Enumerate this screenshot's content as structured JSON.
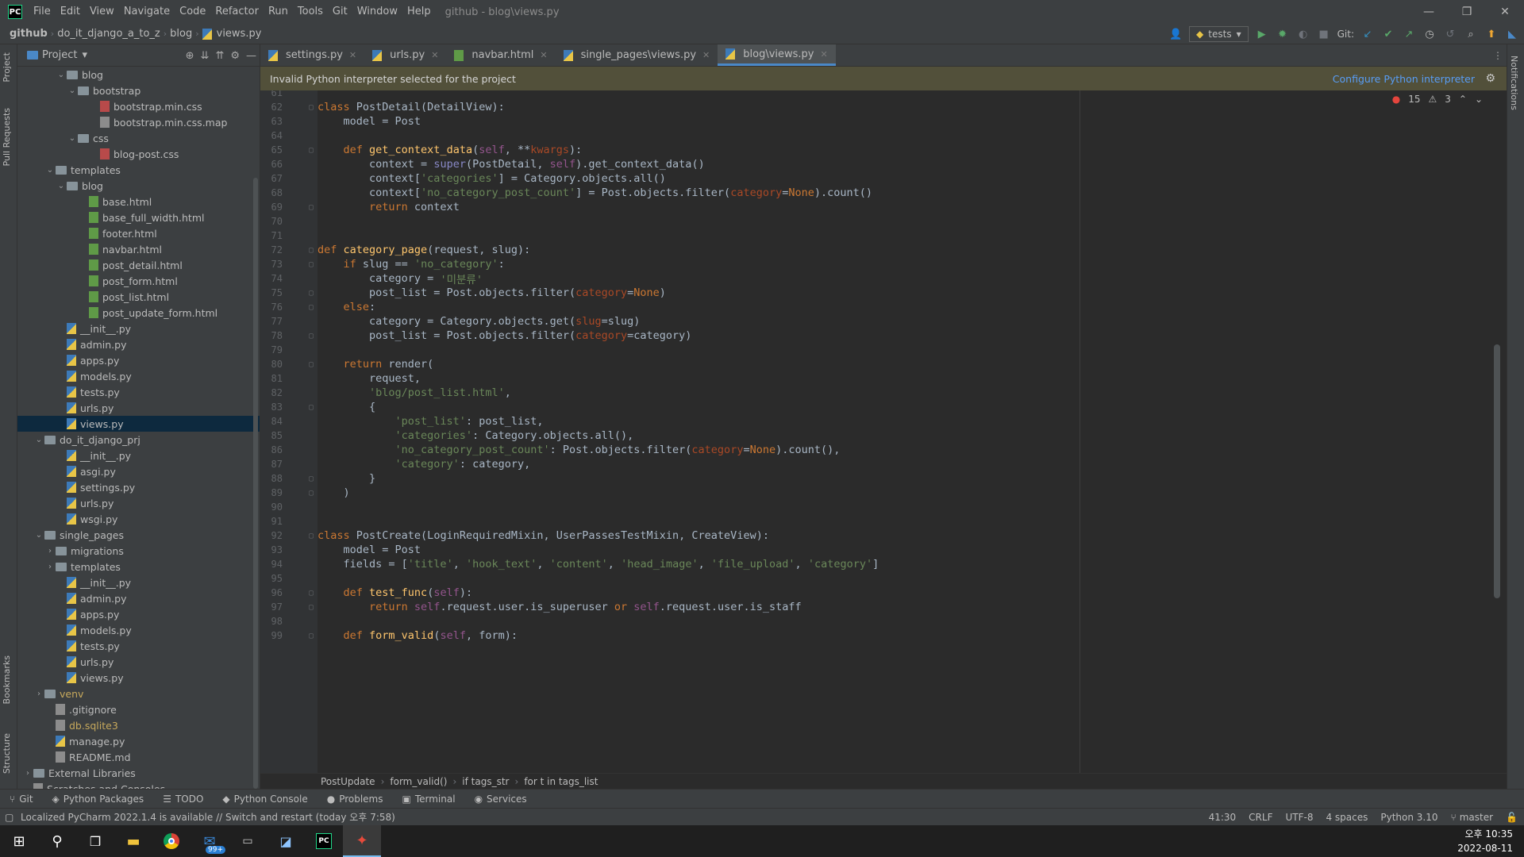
{
  "titlebar": {
    "app_logo": "PC",
    "menu": [
      "File",
      "Edit",
      "View",
      "Navigate",
      "Code",
      "Refactor",
      "Run",
      "Tools",
      "Git",
      "Window",
      "Help"
    ],
    "window_title": "github - blog\\views.py"
  },
  "navbar": {
    "breadcrumbs": [
      "github",
      "do_it_django_a_to_z",
      "blog",
      "views.py"
    ],
    "run_config": "tests",
    "git_label": "Git:"
  },
  "left_strip": {
    "project": "Project",
    "pull_requests": "Pull Requests",
    "bookmarks": "Bookmarks",
    "structure": "Structure"
  },
  "right_strip": {
    "notifications": "Notifications"
  },
  "project_panel": {
    "title": "Project",
    "tree": [
      {
        "label": "blog",
        "type": "folder",
        "depth": 4,
        "open": true
      },
      {
        "label": "bootstrap",
        "type": "folder",
        "depth": 5,
        "open": true
      },
      {
        "label": "bootstrap.min.css",
        "type": "css",
        "depth": 7
      },
      {
        "label": "bootstrap.min.css.map",
        "type": "gen",
        "depth": 7
      },
      {
        "label": "css",
        "type": "folder",
        "depth": 5,
        "open": true
      },
      {
        "label": "blog-post.css",
        "type": "css",
        "depth": 7
      },
      {
        "label": "templates",
        "type": "folder",
        "depth": 3,
        "open": true
      },
      {
        "label": "blog",
        "type": "folder",
        "depth": 4,
        "open": true
      },
      {
        "label": "base.html",
        "type": "html",
        "depth": 6
      },
      {
        "label": "base_full_width.html",
        "type": "html",
        "depth": 6
      },
      {
        "label": "footer.html",
        "type": "html",
        "depth": 6
      },
      {
        "label": "navbar.html",
        "type": "html",
        "depth": 6
      },
      {
        "label": "post_detail.html",
        "type": "html",
        "depth": 6
      },
      {
        "label": "post_form.html",
        "type": "html",
        "depth": 6
      },
      {
        "label": "post_list.html",
        "type": "html",
        "depth": 6
      },
      {
        "label": "post_update_form.html",
        "type": "html",
        "depth": 6
      },
      {
        "label": "__init__.py",
        "type": "py",
        "depth": 4
      },
      {
        "label": "admin.py",
        "type": "py",
        "depth": 4
      },
      {
        "label": "apps.py",
        "type": "py",
        "depth": 4
      },
      {
        "label": "models.py",
        "type": "py",
        "depth": 4
      },
      {
        "label": "tests.py",
        "type": "py",
        "depth": 4
      },
      {
        "label": "urls.py",
        "type": "py",
        "depth": 4
      },
      {
        "label": "views.py",
        "type": "py",
        "depth": 4,
        "selected": true
      },
      {
        "label": "do_it_django_prj",
        "type": "folder",
        "depth": 2,
        "open": true
      },
      {
        "label": "__init__.py",
        "type": "py",
        "depth": 4
      },
      {
        "label": "asgi.py",
        "type": "py",
        "depth": 4
      },
      {
        "label": "settings.py",
        "type": "py",
        "depth": 4
      },
      {
        "label": "urls.py",
        "type": "py",
        "depth": 4
      },
      {
        "label": "wsgi.py",
        "type": "py",
        "depth": 4
      },
      {
        "label": "single_pages",
        "type": "folder",
        "depth": 2,
        "open": true
      },
      {
        "label": "migrations",
        "type": "folder",
        "depth": 3,
        "open": false
      },
      {
        "label": "templates",
        "type": "folder",
        "depth": 3,
        "open": false
      },
      {
        "label": "__init__.py",
        "type": "py",
        "depth": 4
      },
      {
        "label": "admin.py",
        "type": "py",
        "depth": 4
      },
      {
        "label": "apps.py",
        "type": "py",
        "depth": 4
      },
      {
        "label": "models.py",
        "type": "py",
        "depth": 4
      },
      {
        "label": "tests.py",
        "type": "py",
        "depth": 4
      },
      {
        "label": "urls.py",
        "type": "py",
        "depth": 4
      },
      {
        "label": "views.py",
        "type": "py",
        "depth": 4
      },
      {
        "label": "venv",
        "type": "folder",
        "depth": 2,
        "open": false,
        "excluded": true
      },
      {
        "label": ".gitignore",
        "type": "gen",
        "depth": 3
      },
      {
        "label": "db.sqlite3",
        "type": "gen",
        "depth": 3,
        "excluded": true
      },
      {
        "label": "manage.py",
        "type": "py",
        "depth": 3
      },
      {
        "label": "README.md",
        "type": "gen",
        "depth": 3
      },
      {
        "label": "External Libraries",
        "type": "lib",
        "depth": 1,
        "open": false
      },
      {
        "label": "Scratches and Consoles",
        "type": "scratch",
        "depth": 1
      }
    ]
  },
  "tabs": [
    {
      "label": "settings.py",
      "type": "py"
    },
    {
      "label": "urls.py",
      "type": "py"
    },
    {
      "label": "navbar.html",
      "type": "html"
    },
    {
      "label": "single_pages\\views.py",
      "type": "py"
    },
    {
      "label": "blog\\views.py",
      "type": "py",
      "active": true
    }
  ],
  "warning_bar": {
    "message": "Invalid Python interpreter selected for the project",
    "link": "Configure Python interpreter"
  },
  "inspections": {
    "errors": "15",
    "warnings": "3"
  },
  "code_lines": [
    {
      "n": "61",
      "t": []
    },
    {
      "n": "62",
      "f": "▢",
      "t": [
        [
          "kw",
          "class "
        ],
        [
          "code",
          "PostDetail(DetailView):"
        ]
      ]
    },
    {
      "n": "63",
      "t": [
        [
          "code",
          "    model = Post"
        ]
      ]
    },
    {
      "n": "64",
      "t": []
    },
    {
      "n": "65",
      "f": "▢",
      "t": [
        [
          "kw",
          "    def "
        ],
        [
          "fn",
          "get_context_data"
        ],
        [
          "code",
          "("
        ],
        [
          "self",
          "self"
        ],
        [
          "code",
          ", **"
        ],
        [
          "param",
          "kwargs"
        ],
        [
          "code",
          "):"
        ]
      ]
    },
    {
      "n": "66",
      "t": [
        [
          "code",
          "        context = "
        ],
        [
          "bi",
          "super"
        ],
        [
          "code",
          "(PostDetail, "
        ],
        [
          "self",
          "self"
        ],
        [
          "code",
          ").get_context_data()"
        ]
      ]
    },
    {
      "n": "67",
      "t": [
        [
          "code",
          "        context["
        ],
        [
          "str",
          "'categories'"
        ],
        [
          "code",
          "] = Category.objects.all()"
        ]
      ]
    },
    {
      "n": "68",
      "t": [
        [
          "code",
          "        context["
        ],
        [
          "str",
          "'no_category_post_count'"
        ],
        [
          "code",
          "] = Post.objects.filter("
        ],
        [
          "param",
          "category"
        ],
        [
          "code",
          "="
        ],
        [
          "kw",
          "None"
        ],
        [
          "code",
          ").count()"
        ]
      ]
    },
    {
      "n": "69",
      "f": "▢",
      "t": [
        [
          "kw",
          "        return "
        ],
        [
          "code",
          "context"
        ]
      ]
    },
    {
      "n": "70",
      "t": []
    },
    {
      "n": "71",
      "t": []
    },
    {
      "n": "72",
      "f": "▢",
      "t": [
        [
          "kw",
          "def "
        ],
        [
          "fn",
          "category_page"
        ],
        [
          "code",
          "(request, slug):"
        ]
      ]
    },
    {
      "n": "73",
      "f": "▢",
      "t": [
        [
          "kw",
          "    if "
        ],
        [
          "code",
          "slug == "
        ],
        [
          "str",
          "'no_category'"
        ],
        [
          "code",
          ":"
        ]
      ]
    },
    {
      "n": "74",
      "t": [
        [
          "code",
          "        category = "
        ],
        [
          "str",
          "'미분류'"
        ]
      ]
    },
    {
      "n": "75",
      "f": "▢",
      "t": [
        [
          "code",
          "        post_list = Post.objects.filter("
        ],
        [
          "param",
          "category"
        ],
        [
          "code",
          "="
        ],
        [
          "kw",
          "None"
        ],
        [
          "code",
          ")"
        ]
      ]
    },
    {
      "n": "76",
      "f": "▢",
      "t": [
        [
          "kw",
          "    else"
        ],
        [
          "code",
          ":"
        ]
      ]
    },
    {
      "n": "77",
      "t": [
        [
          "code",
          "        category = Category.objects.get("
        ],
        [
          "param",
          "slug"
        ],
        [
          "code",
          "=slug)"
        ]
      ]
    },
    {
      "n": "78",
      "f": "▢",
      "t": [
        [
          "code",
          "        post_list = Post.objects.filter("
        ],
        [
          "param",
          "category"
        ],
        [
          "code",
          "=category)"
        ]
      ]
    },
    {
      "n": "79",
      "t": []
    },
    {
      "n": "80",
      "f": "▢",
      "t": [
        [
          "kw",
          "    return "
        ],
        [
          "code",
          "render("
        ]
      ]
    },
    {
      "n": "81",
      "t": [
        [
          "code",
          "        request,"
        ]
      ]
    },
    {
      "n": "82",
      "t": [
        [
          "str",
          "        'blog/post_list.html'"
        ],
        [
          "code",
          ","
        ]
      ]
    },
    {
      "n": "83",
      "f": "▢",
      "t": [
        [
          "code",
          "        {"
        ]
      ]
    },
    {
      "n": "84",
      "t": [
        [
          "str",
          "            'post_list'"
        ],
        [
          "code",
          ": post_list,"
        ]
      ]
    },
    {
      "n": "85",
      "t": [
        [
          "str",
          "            'categories'"
        ],
        [
          "code",
          ": Category.objects.all(),"
        ]
      ]
    },
    {
      "n": "86",
      "t": [
        [
          "str",
          "            'no_category_post_count'"
        ],
        [
          "code",
          ": Post.objects.filter("
        ],
        [
          "param",
          "category"
        ],
        [
          "code",
          "="
        ],
        [
          "kw",
          "None"
        ],
        [
          "code",
          ").count(),"
        ]
      ]
    },
    {
      "n": "87",
      "t": [
        [
          "str",
          "            'category'"
        ],
        [
          "code",
          ": category,"
        ]
      ]
    },
    {
      "n": "88",
      "f": "▢",
      "t": [
        [
          "code",
          "        }"
        ]
      ]
    },
    {
      "n": "89",
      "f": "▢",
      "t": [
        [
          "code",
          "    )"
        ]
      ]
    },
    {
      "n": "90",
      "t": []
    },
    {
      "n": "91",
      "t": []
    },
    {
      "n": "92",
      "f": "▢",
      "t": [
        [
          "kw",
          "class "
        ],
        [
          "code",
          "PostCreate(LoginRequiredMixin, UserPassesTestMixin, CreateView):"
        ]
      ]
    },
    {
      "n": "93",
      "t": [
        [
          "code",
          "    model = Post"
        ]
      ]
    },
    {
      "n": "94",
      "t": [
        [
          "code",
          "    fields = ["
        ],
        [
          "str",
          "'title'"
        ],
        [
          "code",
          ", "
        ],
        [
          "str",
          "'hook_text'"
        ],
        [
          "code",
          ", "
        ],
        [
          "str",
          "'content'"
        ],
        [
          "code",
          ", "
        ],
        [
          "str",
          "'head_image'"
        ],
        [
          "code",
          ", "
        ],
        [
          "str",
          "'file_upload'"
        ],
        [
          "code",
          ", "
        ],
        [
          "str",
          "'category'"
        ],
        [
          "code",
          "]"
        ]
      ]
    },
    {
      "n": "95",
      "t": []
    },
    {
      "n": "96",
      "f": "▢",
      "t": [
        [
          "kw",
          "    def "
        ],
        [
          "fn",
          "test_func"
        ],
        [
          "code",
          "("
        ],
        [
          "self",
          "self"
        ],
        [
          "code",
          "):"
        ]
      ]
    },
    {
      "n": "97",
      "f": "▢",
      "t": [
        [
          "kw",
          "        return "
        ],
        [
          "self",
          "self"
        ],
        [
          "code",
          ".request.user.is_superuser "
        ],
        [
          "kw",
          "or "
        ],
        [
          "self",
          "self"
        ],
        [
          "code",
          ".request.user.is_staff"
        ]
      ]
    },
    {
      "n": "98",
      "t": []
    },
    {
      "n": "99",
      "f": "▢",
      "t": [
        [
          "kw",
          "    def "
        ],
        [
          "fn",
          "form_valid"
        ],
        [
          "code",
          "("
        ],
        [
          "self",
          "self"
        ],
        [
          "code",
          ", form):"
        ]
      ]
    }
  ],
  "editor_breadcrumb": [
    "PostUpdate",
    "form_valid()",
    "if tags_str",
    "for t in tags_list"
  ],
  "toolwindows": [
    {
      "icon": "⑂",
      "label": "Git"
    },
    {
      "icon": "◈",
      "label": "Python Packages"
    },
    {
      "icon": "☰",
      "label": "TODO"
    },
    {
      "icon": "◆",
      "label": "Python Console"
    },
    {
      "icon": "●",
      "label": "Problems"
    },
    {
      "icon": "▣",
      "label": "Terminal"
    },
    {
      "icon": "◉",
      "label": "Services"
    }
  ],
  "statusbar": {
    "message": "Localized PyCharm 2022.1.4 is available // Switch and restart (today 오후 7:58)",
    "position": "41:30",
    "line_sep": "CRLF",
    "encoding": "UTF-8",
    "indent": "4 spaces",
    "interpreter": "Python 3.10",
    "branch": "master"
  },
  "taskbar": {
    "badge": "99+",
    "time": "오후 10:35",
    "date": "2022-08-11"
  },
  "colors": {
    "accent": "#4a88c7",
    "error": "#e5453d",
    "warning_bg": "#52503a",
    "link": "#589df6"
  }
}
